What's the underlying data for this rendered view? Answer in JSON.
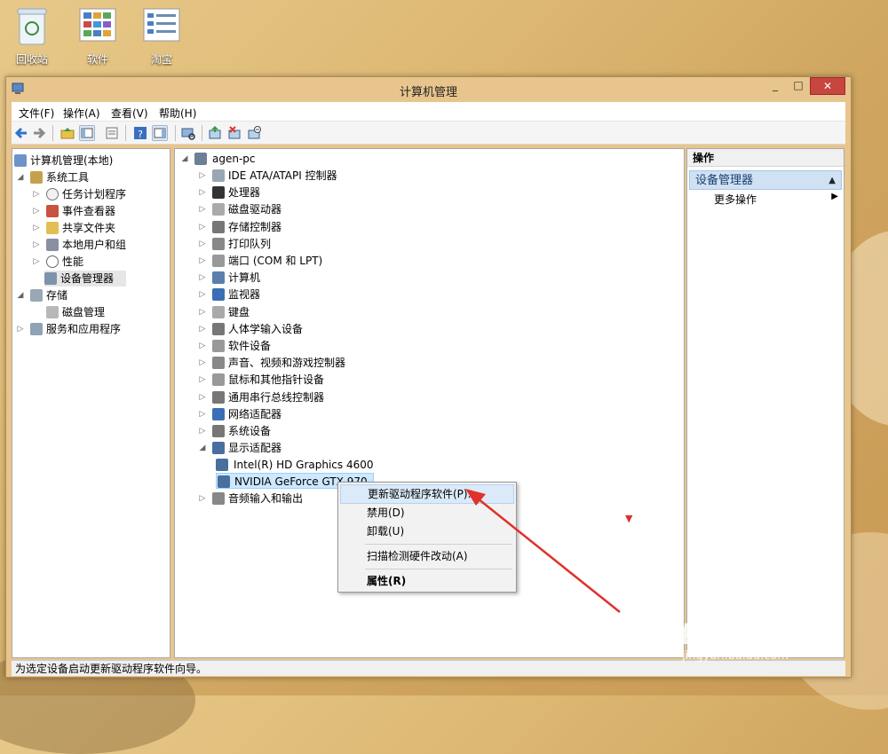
{
  "desktop": {
    "icons": [
      {
        "label": "回收站",
        "icon": "recycle-bin-icon"
      },
      {
        "label": "软件",
        "icon": "software-folder-icon"
      },
      {
        "label": "淘宝",
        "icon": "taobao-list-icon"
      }
    ]
  },
  "window": {
    "title": "计算机管理",
    "controls": {
      "minimize": "_",
      "maximize": "□",
      "close": "✕"
    }
  },
  "menubar": {
    "items": [
      "文件(F)",
      "操作(A)",
      "查看(V)",
      "帮助(H)"
    ]
  },
  "toolbar": {
    "icons": [
      "back-arrow-icon",
      "forward-arrow-icon",
      "up-folder-icon",
      "show-hide-console-tree-icon",
      "export-list-icon",
      "help-icon",
      "show-hide-action-pane-icon",
      "scan-hardware-icon",
      "update-driver-icon",
      "uninstall-device-icon",
      "disable-device-icon"
    ]
  },
  "left_tree": {
    "root": "计算机管理(本地)",
    "system_tools": "系统工具",
    "task_scheduler": "任务计划程序",
    "event_viewer": "事件查看器",
    "shared_folders": "共享文件夹",
    "local_users": "本地用户和组",
    "performance": "性能",
    "device_manager": "设备管理器",
    "storage": "存储",
    "disk_management": "磁盘管理",
    "services_apps": "服务和应用程序"
  },
  "device_tree": {
    "computer": "agen-pc",
    "categories": [
      "IDE ATA/ATAPI 控制器",
      "处理器",
      "磁盘驱动器",
      "存储控制器",
      "打印队列",
      "端口 (COM 和 LPT)",
      "计算机",
      "监视器",
      "键盘",
      "人体学输入设备",
      "软件设备",
      "声音、视频和游戏控制器",
      "鼠标和其他指针设备",
      "通用串行总线控制器",
      "网络适配器",
      "系统设备",
      "显示适配器"
    ],
    "display_children": [
      "Intel(R) HD Graphics 4600",
      "NVIDIA GeForce GTX 970"
    ],
    "audio_io": "音频输入和输出"
  },
  "context_menu": {
    "update_driver": "更新驱动程序软件(P)...",
    "disable": "禁用(D)",
    "uninstall": "卸载(U)",
    "scan": "扫描检测硬件改动(A)",
    "properties": "属性(R)"
  },
  "actions_pane": {
    "header": "操作",
    "section": "设备管理器",
    "more": "更多操作"
  },
  "statusbar": {
    "text": "为选定设备启动更新驱动程序软件向导。"
  },
  "watermark": {
    "brand": "Bai经验",
    "url": "jingyan.baidu.com"
  },
  "colors": {
    "accent_red": "#d9322c",
    "close_button": "#c7463f",
    "selection_blue": "#cde8ff",
    "wallpaper": "#dcb772"
  }
}
